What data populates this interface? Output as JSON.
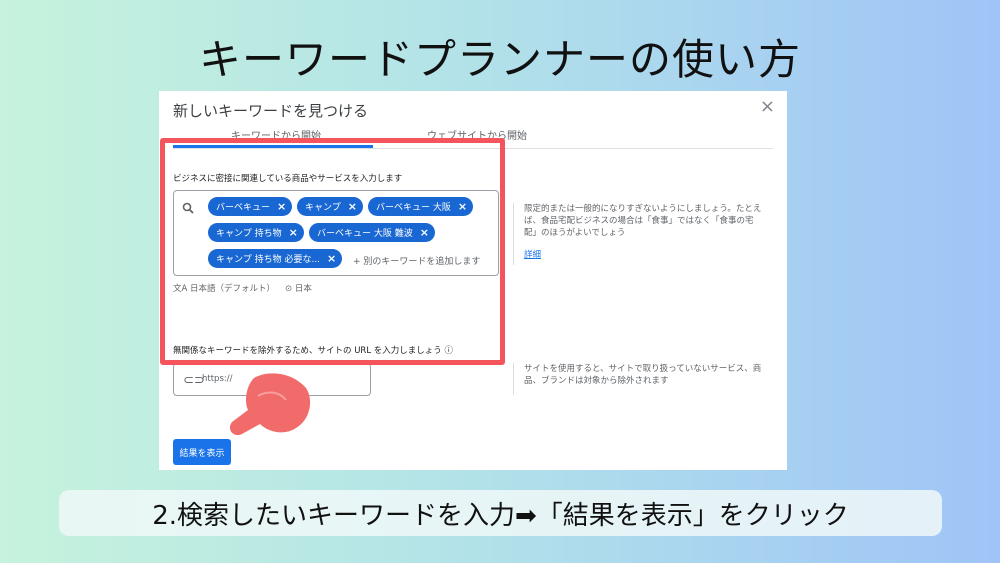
{
  "title": "キーワードプランナーの使い方",
  "dialog": {
    "title": "新しいキーワードを見つける",
    "close_label": "×",
    "tabs": [
      {
        "label": "キーワードから開始",
        "active": true
      },
      {
        "label": "ウェブサイトから開始",
        "active": false
      }
    ],
    "keyword_prompt": "ビジネスに密接に関連している商品やサービスを入力します",
    "chips": [
      {
        "label": "バーベキュー"
      },
      {
        "label": "キャンプ"
      },
      {
        "label": "バーベキュー 大阪"
      },
      {
        "label": "キャンプ 持ち物"
      },
      {
        "label": "バーベキュー 大阪 難波"
      },
      {
        "label": "キャンプ 持ち物 必要な..."
      }
    ],
    "chip_remove_label": "×",
    "add_placeholder": "+ 別のキーワードを追加します",
    "hint": "限定的または一般的になりすぎないようにしましょう。たとえば、食品宅配ビジネスの場合は「食事」ではなく「食事の宅配」のほうがよいでしょう",
    "hint_link": "詳細",
    "language": "日本語（デフォルト）",
    "location": "日本",
    "url_prompt": "無関係なキーワードを除外するため、サイトの URL を入力しましょう",
    "url_placeholder": "https://",
    "url_hint": "サイトを使用すると、サイトで取り扱っていないサービス、商品、ブランドは対象から除外されます",
    "submit_label": "結果を表示"
  },
  "caption": "2.検索したいキーワードを入力➡「結果を表示」をクリック",
  "colors": {
    "accent_blue": "#1a73e8",
    "chip_blue": "#1967d2",
    "highlight_red": "#f4545b",
    "pointer_coral": "#f26b6b"
  }
}
